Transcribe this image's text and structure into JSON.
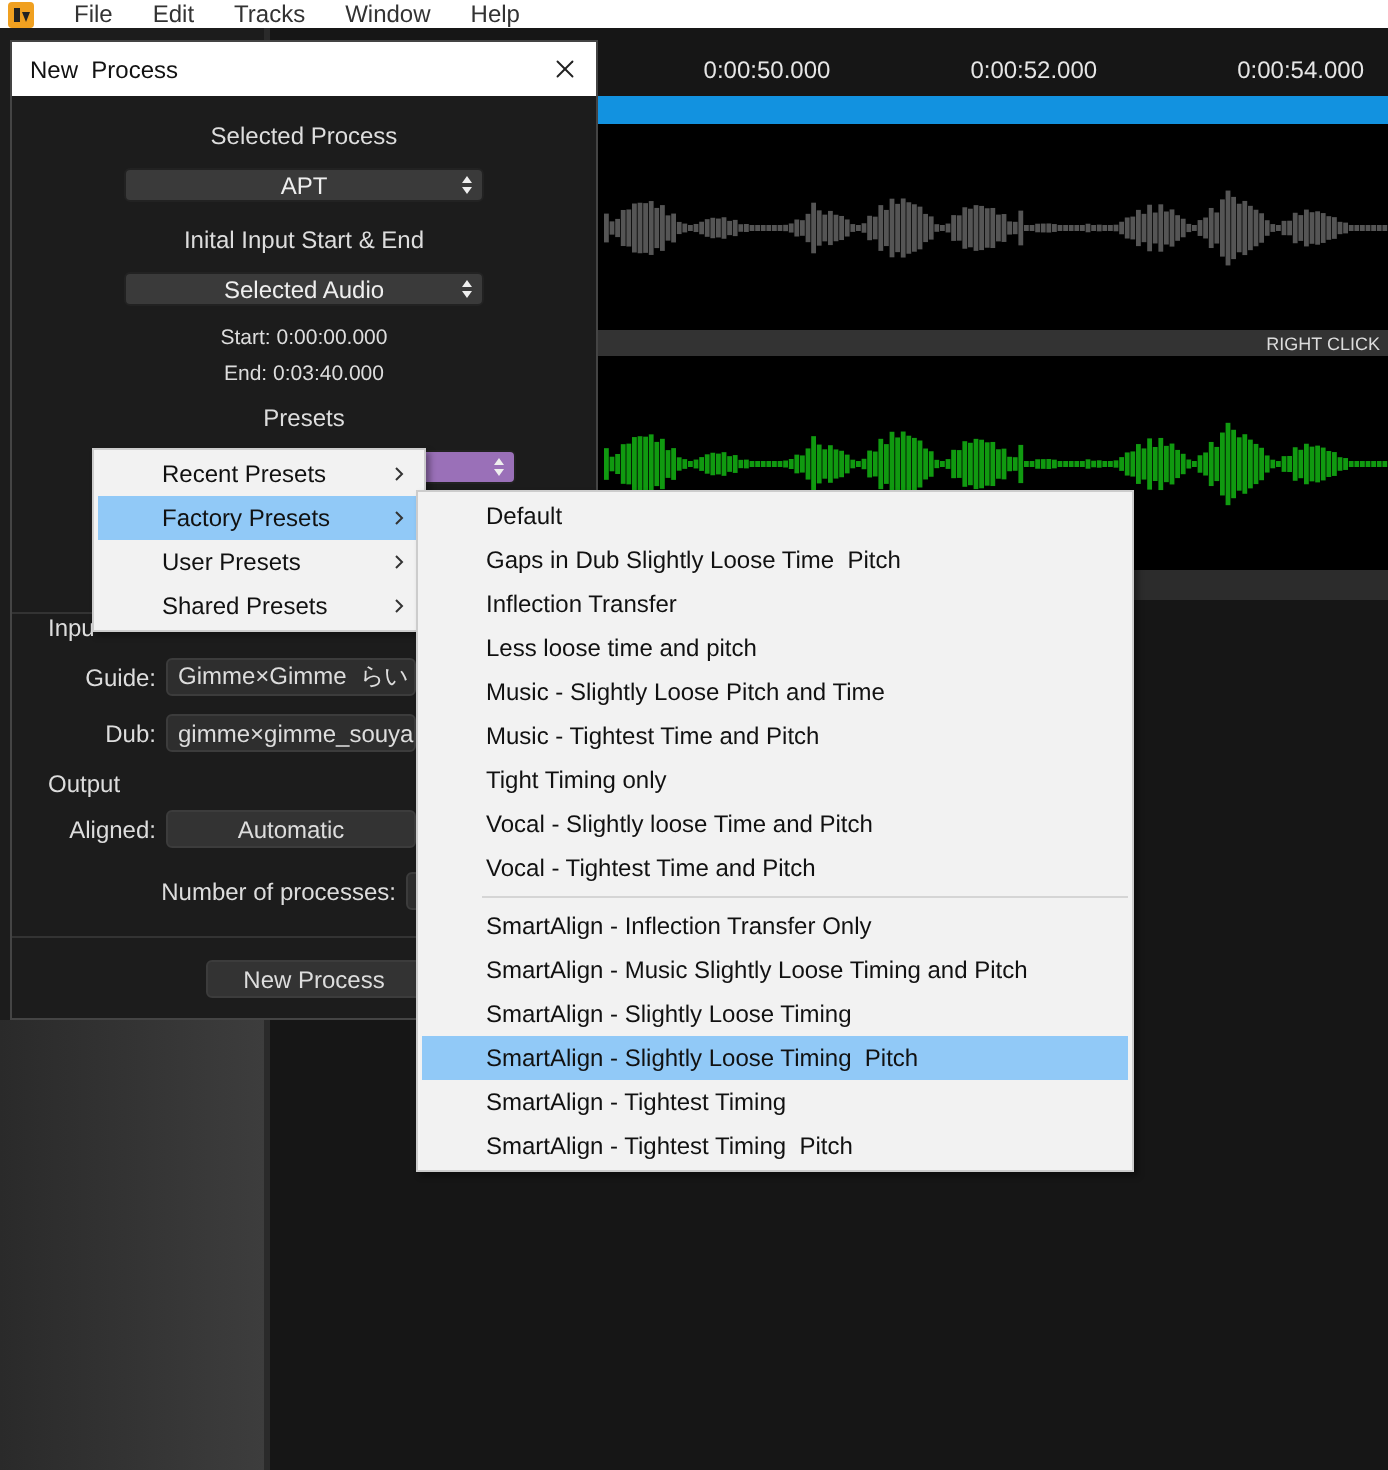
{
  "menubar": {
    "items": [
      "File",
      "Edit",
      "Tracks",
      "Window",
      "Help"
    ]
  },
  "timeline": {
    "ticks": [
      "0:00:50.000",
      "0:00:52.000",
      "0:00:54.000"
    ]
  },
  "track_header": {
    "hint": "RIGHT CLICK"
  },
  "dialog": {
    "title": "New  Process",
    "process_label": "Selected Process",
    "process_value": "APT",
    "range_label": "Inital Input Start & End",
    "range_value": "Selected Audio",
    "start": "Start: 0:00:00.000",
    "end": "End: 0:03:40.000",
    "presets_label": "Presets",
    "input_label": "Inpu",
    "guide_label": "Guide:",
    "guide_value": "Gimme×Gimme  らい",
    "dub_label": "Dub:",
    "dub_value": "gimme×gimme_souya",
    "output_label": "Output",
    "aligned_label": "Aligned:",
    "aligned_value": "Automatic",
    "processes_label": "Number of processes:",
    "submit": "New Process"
  },
  "presets_menu": {
    "items": [
      {
        "label": "Recent Presets",
        "selected": false
      },
      {
        "label": "Factory Presets",
        "selected": true
      },
      {
        "label": "User Presets",
        "selected": false
      },
      {
        "label": "Shared Presets",
        "selected": false
      }
    ]
  },
  "factory_menu": {
    "groups": [
      {
        "items": [
          {
            "label": "Default",
            "selected": false
          },
          {
            "label": "Gaps in Dub Slightly Loose Time  Pitch",
            "selected": false
          },
          {
            "label": "Inflection Transfer",
            "selected": false
          },
          {
            "label": "Less loose time and pitch",
            "selected": false
          },
          {
            "label": "Music - Slightly Loose Pitch and Time",
            "selected": false
          },
          {
            "label": "Music - Tightest Time and Pitch",
            "selected": false
          },
          {
            "label": "Tight Timing only",
            "selected": false
          },
          {
            "label": "Vocal - Slightly loose Time and Pitch",
            "selected": false
          },
          {
            "label": "Vocal - Tightest Time and Pitch",
            "selected": false
          }
        ]
      },
      {
        "items": [
          {
            "label": "SmartAlign - Inflection Transfer Only",
            "selected": false
          },
          {
            "label": "SmartAlign - Music Slightly Loose Timing and Pitch",
            "selected": false
          },
          {
            "label": "SmartAlign - Slightly Loose Timing",
            "selected": false
          },
          {
            "label": "SmartAlign - Slightly Loose Timing  Pitch",
            "selected": true
          },
          {
            "label": "SmartAlign - Tightest Timing",
            "selected": false
          },
          {
            "label": "SmartAlign - Tightest Timing  Pitch",
            "selected": false
          }
        ]
      }
    ]
  }
}
